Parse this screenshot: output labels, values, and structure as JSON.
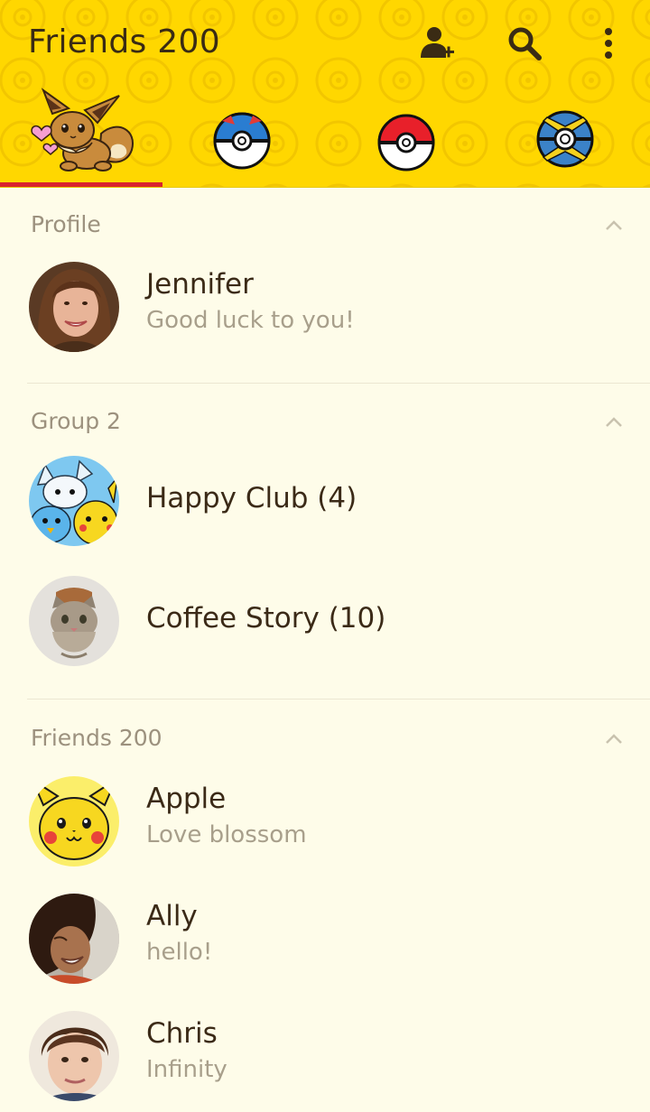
{
  "header": {
    "title": "Friends 200",
    "icons": [
      "add-friend-icon",
      "search-icon",
      "more-vert-icon"
    ],
    "tabs": [
      {
        "icon": "eevee-icon",
        "selected": true
      },
      {
        "icon": "great-ball-icon",
        "selected": false
      },
      {
        "icon": "poke-ball-icon",
        "selected": false
      },
      {
        "icon": "quick-ball-icon",
        "selected": false
      }
    ]
  },
  "colors": {
    "header_bg": "#ffd700",
    "accent_indicator": "#d9232d",
    "list_bg": "#fefce9",
    "name_text": "#3b2a17",
    "secondary_text": "#a89f8b"
  },
  "sections": [
    {
      "title": "Profile",
      "rows": [
        {
          "name": "Jennifer",
          "status": "Good luck to you!",
          "avatar": "photo-avatar"
        }
      ]
    },
    {
      "title": "Group 2",
      "rows": [
        {
          "name": "Happy Club (4)",
          "avatar": "pokemon-group-avatar"
        },
        {
          "name": "Coffee Story (10)",
          "avatar": "cat-avatar"
        }
      ]
    },
    {
      "title": "Friends 200",
      "rows": [
        {
          "name": "Apple",
          "status": "Love blossom",
          "avatar": "pikachu-avatar"
        },
        {
          "name": "Ally",
          "status": "hello!",
          "avatar": "photo-avatar"
        },
        {
          "name": "Chris",
          "status": "Infinity",
          "avatar": "photo-avatar"
        }
      ]
    }
  ]
}
